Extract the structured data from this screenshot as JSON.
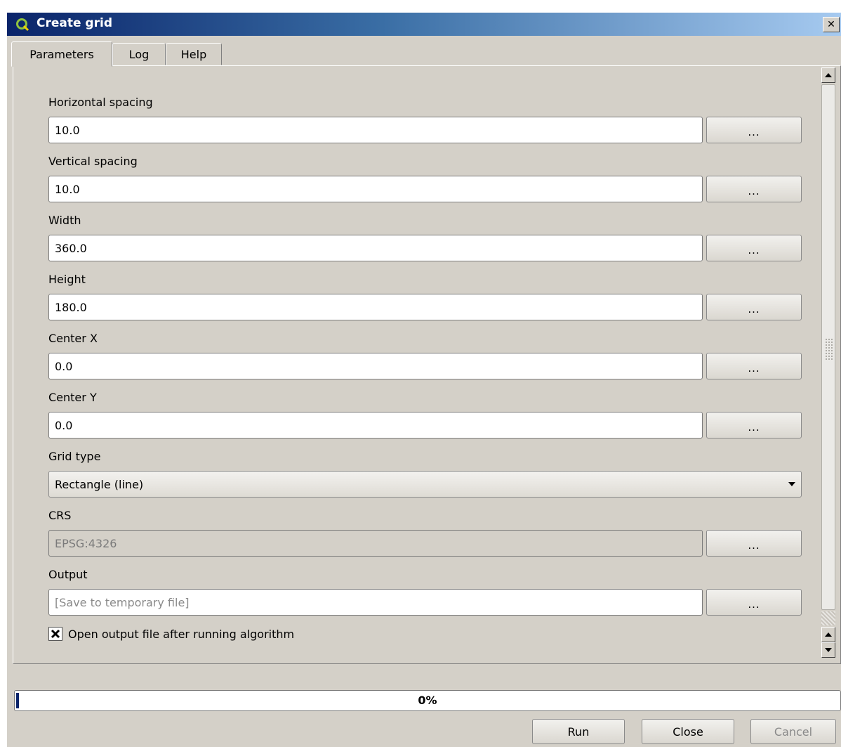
{
  "window": {
    "title": "Create grid",
    "close_glyph": "✕",
    "icon": "qgis-icon"
  },
  "tabs": [
    {
      "label": "Parameters",
      "active": true
    },
    {
      "label": "Log",
      "active": false
    },
    {
      "label": "Help",
      "active": false
    }
  ],
  "parameters": {
    "horizontal_spacing": {
      "label": "Horizontal spacing",
      "value": "10.0"
    },
    "vertical_spacing": {
      "label": "Vertical spacing",
      "value": "10.0"
    },
    "width": {
      "label": "Width",
      "value": "360.0"
    },
    "height": {
      "label": "Height",
      "value": "180.0"
    },
    "center_x": {
      "label": "Center X",
      "value": "0.0"
    },
    "center_y": {
      "label": "Center Y",
      "value": "0.0"
    },
    "grid_type": {
      "label": "Grid type",
      "value": "Rectangle (line)"
    },
    "crs": {
      "label": "CRS",
      "value": "EPSG:4326"
    },
    "output": {
      "label": "Output",
      "placeholder": "[Save to temporary file]"
    },
    "open_output": {
      "label": "Open output file after running algorithm",
      "checked": true
    }
  },
  "browse_label": "...",
  "progress": {
    "value": 0,
    "text": "0%"
  },
  "buttons": {
    "run": "Run",
    "close": "Close",
    "cancel": "Cancel"
  }
}
